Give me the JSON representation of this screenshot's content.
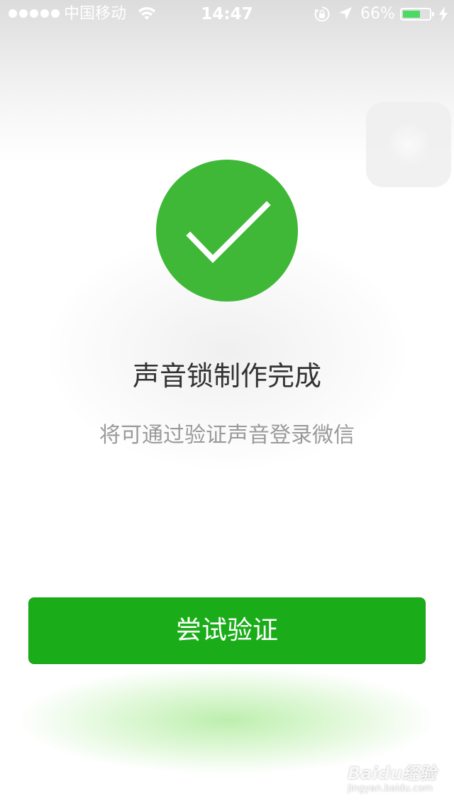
{
  "status_bar": {
    "carrier": "中国移动",
    "time": "14:47",
    "battery_percent": "66%",
    "battery_level": 0.66,
    "signal_dots": 5,
    "icons": [
      "signal-dots-icon",
      "wifi-icon",
      "rotation-lock-icon",
      "location-arrow-icon",
      "battery-icon",
      "charging-bolt-icon"
    ]
  },
  "main": {
    "status_icon": "checkmark-icon",
    "title": "声音锁制作完成",
    "subtitle": "将可通过验证声音登录微信",
    "primary_button_label": "尝试验证"
  },
  "watermark": {
    "logo": "Baidu经验",
    "url": "jingyan.baidu.com"
  },
  "colors": {
    "success_green": "#3fb837",
    "button_green": "#1aad19",
    "battery_green": "#4cd964",
    "title_text": "#333333",
    "subtitle_text": "#9a9a9a"
  }
}
